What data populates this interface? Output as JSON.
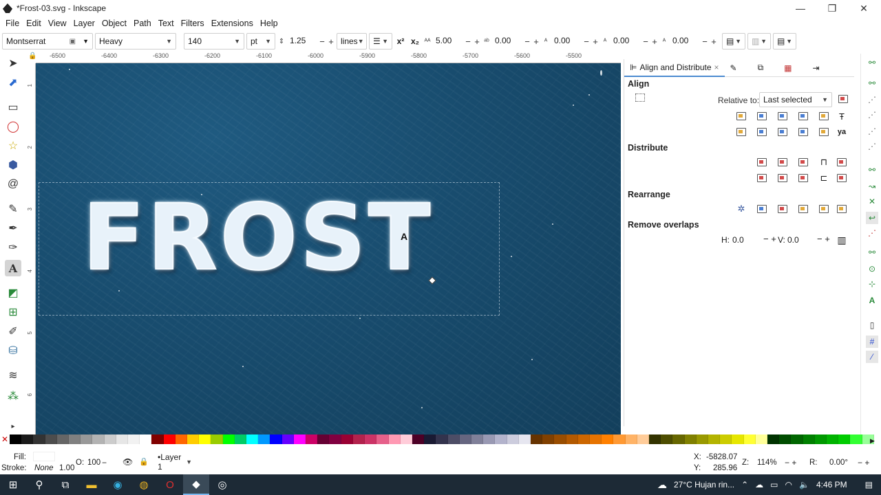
{
  "window": {
    "title": "*Frost-03.svg - Inkscape",
    "minimize": "—",
    "restore": "❐",
    "close": "✕"
  },
  "menu": [
    "File",
    "Edit",
    "View",
    "Layer",
    "Object",
    "Path",
    "Text",
    "Filters",
    "Extensions",
    "Help"
  ],
  "text_toolbar": {
    "font_family": "Montserrat",
    "font_style": "Heavy",
    "font_size": "140",
    "unit": "pt",
    "line_height": "1.25",
    "spacing_mode": "lines",
    "letter_spacing": "5.00",
    "word_spacing": "0.00",
    "kerning_h": "0.00",
    "kerning_v": "0.00",
    "rotation": "0.00"
  },
  "ruler": {
    "h_ticks": [
      "-6500",
      "-6400",
      "-6300",
      "-6200",
      "-6100",
      "-6000",
      "-5900",
      "-5800",
      "-5700",
      "-5600",
      "-5500"
    ],
    "v_ticks": [
      "1",
      "2",
      "3",
      "4",
      "5",
      "6"
    ]
  },
  "canvas": {
    "text": "FROST",
    "cursor_glyph": "A"
  },
  "panel": {
    "tab_label": "Align and Distribute",
    "tab_close": "×",
    "align_title": "Align",
    "relative_label": "Relative to:",
    "relative_value": "Last selected",
    "distribute_title": "Distribute",
    "rearrange_title": "Rearrange",
    "remove_overlaps_title": "Remove overlaps",
    "h_label": "H:",
    "h_value": "0.0",
    "v_label": "V:",
    "v_value": "0.0"
  },
  "palette": [
    "#000000",
    "#1a1a1a",
    "#333333",
    "#4d4d4d",
    "#666666",
    "#808080",
    "#999999",
    "#b3b3b3",
    "#cccccc",
    "#e6e6e6",
    "#f2f2f2",
    "#ffffff",
    "#800000",
    "#ff0000",
    "#ff6600",
    "#ffcc00",
    "#ffff00",
    "#99cc00",
    "#00ff00",
    "#00cc66",
    "#00ffff",
    "#0099ff",
    "#0000ff",
    "#6600ff",
    "#ff00ff",
    "#cc0066",
    "#660033",
    "#800040",
    "#990033",
    "#b3224d",
    "#cc3366",
    "#e6608a",
    "#ff99b3",
    "#ffccd9",
    "#4d0026",
    "#1a1a33",
    "#33334d",
    "#4d4d66",
    "#666680",
    "#808099",
    "#9999b3",
    "#b3b3cc",
    "#ccccdd",
    "#e6e6f0",
    "#663300",
    "#804000",
    "#994d00",
    "#b35900",
    "#cc6600",
    "#e67300",
    "#ff8000",
    "#ff9933",
    "#ffb366",
    "#ffcc99",
    "#333300",
    "#4d4d00",
    "#666600",
    "#808000",
    "#999900",
    "#b3b300",
    "#cccc00",
    "#e6e600",
    "#ffff33",
    "#ffff99",
    "#003300",
    "#004d00",
    "#006600",
    "#008000",
    "#009900",
    "#00b300",
    "#00cc00",
    "#33ff33",
    "#99ff99"
  ],
  "status": {
    "fill_label": "Fill:",
    "stroke_label": "Stroke:",
    "stroke_value": "None",
    "stroke_width": "1.00",
    "opacity_label": "O:",
    "opacity_value": "100",
    "layer": "•Layer 1",
    "x_label": "X:",
    "x_value": "-5828.07",
    "y_label": "Y:",
    "y_value": "285.96",
    "zoom_label": "Z:",
    "zoom_value": "114%",
    "rotate_label": "R:",
    "rotate_value": "0.00°"
  },
  "taskbar": {
    "weather": "27°C  Hujan rin...",
    "time": "4:46 PM"
  }
}
